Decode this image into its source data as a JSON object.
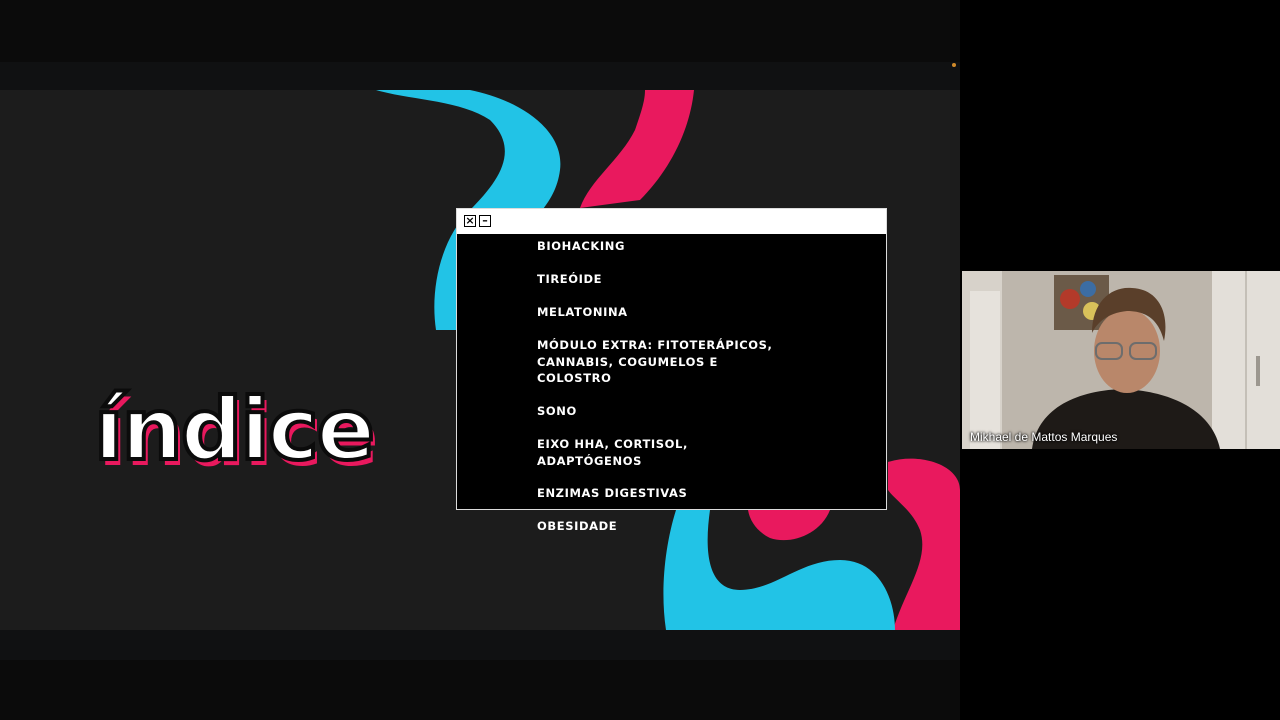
{
  "slide": {
    "title": "índice",
    "colors": {
      "cyan": "#22c3e6",
      "pink": "#e9195e",
      "background": "#1c1c1c"
    }
  },
  "toc": {
    "close_icon": "close-icon",
    "minimize_icon": "minimize-icon",
    "items": [
      "BIOHACKING",
      "TIREÓIDE",
      " MELATONINA",
      "MÓDULO EXTRA: FITOTERÁPICOS,\nCANNABIS, COGUMELOS E\nCOLOSTRO",
      "SONO",
      "EIXO HHA, CORTISOL,\nADAPTÓGENOS",
      "ENZIMAS DIGESTIVAS",
      "OBESIDADE"
    ]
  },
  "participant": {
    "name": "Mikhael de Mattos Marques"
  }
}
